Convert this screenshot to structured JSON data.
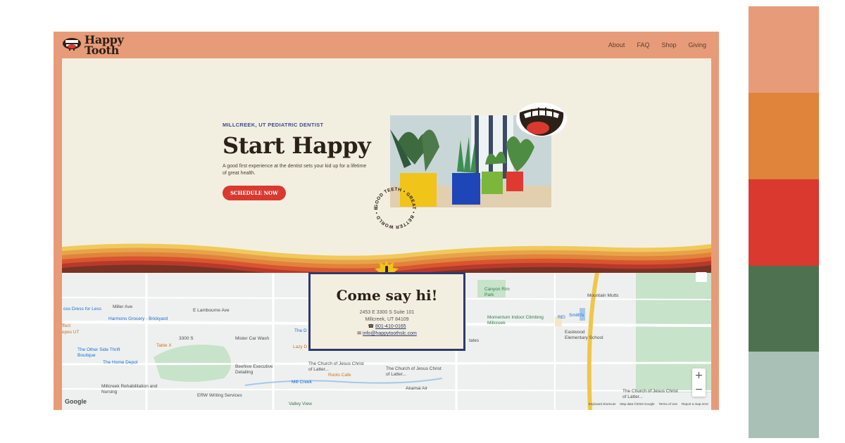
{
  "brand": {
    "name_line1": "Happy",
    "name_line2": "Tooth"
  },
  "nav": {
    "items": [
      "About",
      "FAQ",
      "Shop",
      "Giving"
    ]
  },
  "hero": {
    "eyebrow": "MILLCREEK, UT PEDIATRIC DENTIST",
    "headline": "Start Happy",
    "subline": "A good first experience at the dentist sets your kid up for a lifetime of great health.",
    "cta": "SCHEDULE NOW",
    "stamp_text": "GOOD TEETH • GREAT • BETTER WORLD • EDIT"
  },
  "contact": {
    "title": "Come say hi!",
    "address1": "2453 E 3300 S Suite 101",
    "address2": "Millcreek, UT 84109",
    "phone": "801-410-0165",
    "email": "info@happytoothslc.com"
  },
  "map": {
    "labels": {
      "harmons": "Harmons Grocery - Brickyard",
      "dress": "oss Dress for Less",
      "effect": "ffect",
      "pes": "epes UT",
      "other_side": "The Other Side Thrift Boutique",
      "home_depot": "The Home Depot",
      "table_x": "Table X",
      "mister": "Mister Car Wash",
      "lazy": "Lazy D",
      "beehive": "Beehive Executive Detailing",
      "church1": "The Church of Jesus Christ of Latter...",
      "church2": "The Church of Jesus Christ of Latter...",
      "church3": "The Church of Jesus Christ of Latter...",
      "millcreek_rehab": "Millcreek Rehabilitation and Nursing",
      "erw": "ERW Writing Services",
      "roots": "Roots Cafe",
      "akamai": "Akamai Air",
      "valley_view": "Valley View",
      "canyon_rim": "Canyon Rim Park",
      "momentum": "Momentum Indoor Climbing Millcreek",
      "rei": "REI",
      "smiths": "Smith's",
      "mountain_mutts": "Mountain Mutts",
      "eastwood": "Eastwood Elementary School",
      "mill_creek": "Mill Creek",
      "s3300": "3300 S",
      "lamb": "E Lambourne Ave",
      "miller": "Miller Ave",
      "states": "tates",
      "the_d": "The D"
    },
    "zoom_in": "+",
    "zoom_out": "−",
    "google": "Google",
    "attribution": [
      "Keyboard shortcuts",
      "Map data ©2023 Google",
      "Terms of Use",
      "Report a map error"
    ]
  },
  "palette": [
    "#e89b78",
    "#e0833b",
    "#d9392f",
    "#4e7150",
    "#a8c0b6"
  ],
  "icons": {
    "logo": "mouth-mascot-icon",
    "sticker": "smiling-mouth-icon",
    "sun": "exclamation-sun-icon",
    "phone": "phone-icon",
    "email": "mail-icon"
  }
}
